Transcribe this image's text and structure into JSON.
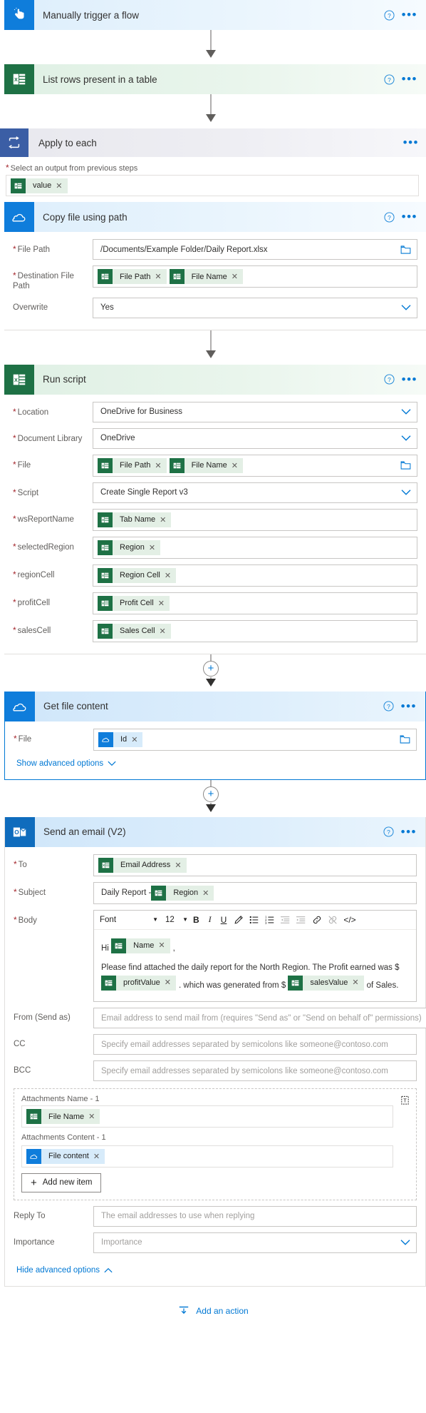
{
  "flow": {
    "trigger": {
      "title": "Manually trigger a flow",
      "icon": "manual-trigger-icon"
    },
    "list_rows": {
      "title": "List rows present in a table",
      "icon": "excel-icon"
    },
    "apply_to_each": {
      "title": "Apply to each",
      "icon": "loop-icon",
      "field_label": "Select an output from previous steps",
      "token": "value"
    },
    "copy_file": {
      "title": "Copy file using path",
      "icon": "onedrive-icon",
      "fields": [
        {
          "label": "File Path",
          "required": true,
          "type": "text",
          "value": "/Documents/Example Folder/Daily Report.xlsx",
          "trailing": "folder-icon"
        },
        {
          "label": "Destination File Path",
          "required": true,
          "type": "tokens",
          "tokens": [
            "File Path",
            "File Name"
          ]
        },
        {
          "label": "Overwrite",
          "required": false,
          "type": "dropdown",
          "value": "Yes"
        }
      ]
    },
    "run_script": {
      "title": "Run script",
      "icon": "excel-icon",
      "fields": [
        {
          "label": "Location",
          "required": true,
          "type": "dropdown",
          "value": "OneDrive for Business"
        },
        {
          "label": "Document Library",
          "required": true,
          "type": "dropdown",
          "value": "OneDrive"
        },
        {
          "label": "File",
          "required": true,
          "type": "tokens",
          "tokens": [
            "File Path",
            "File Name"
          ],
          "trailing": "folder-icon"
        },
        {
          "label": "Script",
          "required": true,
          "type": "dropdown",
          "value": "Create Single Report v3"
        },
        {
          "label": "wsReportName",
          "required": true,
          "type": "tokens",
          "tokens": [
            "Tab Name"
          ]
        },
        {
          "label": "selectedRegion",
          "required": true,
          "type": "tokens",
          "tokens": [
            "Region"
          ]
        },
        {
          "label": "regionCell",
          "required": true,
          "type": "tokens",
          "tokens": [
            "Region Cell"
          ]
        },
        {
          "label": "profitCell",
          "required": true,
          "type": "tokens",
          "tokens": [
            "Profit Cell"
          ]
        },
        {
          "label": "salesCell",
          "required": true,
          "type": "tokens",
          "tokens": [
            "Sales Cell"
          ]
        }
      ]
    },
    "get_file_content": {
      "title": "Get file content",
      "icon": "onedrive-icon",
      "file_label": "File",
      "file_token": "Id",
      "advanced_link": "Show advanced options"
    },
    "send_email": {
      "title": "Send an email (V2)",
      "icon": "outlook-icon",
      "to_label": "To",
      "to_token": "Email Address",
      "subject_label": "Subject",
      "subject_text": "Daily Report - ",
      "subject_token": "Region",
      "body_label": "Body",
      "toolbar": {
        "font": "Font",
        "size": "12",
        "bold": "B",
        "italic": "I",
        "underline": "U"
      },
      "body": {
        "greeting_prefix": "Hi",
        "greeting_token": "Name",
        "greeting_suffix": ",",
        "para_part1": "Please find attached the daily report for the North Region.  The Profit earned was $",
        "token_profit": "profitValue",
        "para_part2": ". which was generated from $",
        "token_sales": "salesValue",
        "para_part3": "of Sales."
      },
      "from_label": "From (Send as)",
      "from_placeholder": "Email address to send mail from (requires \"Send as\" or \"Send on behalf of\" permissions)",
      "cc_label": "CC",
      "cc_placeholder": "Specify email addresses separated by semicolons like someone@contoso.com",
      "bcc_label": "BCC",
      "bcc_placeholder": "Specify email addresses separated by semicolons like someone@contoso.com",
      "attachments": {
        "name_label": "Attachments Name - 1",
        "name_token": "File Name",
        "content_label": "Attachments Content - 1",
        "content_token": "File content",
        "add_button": "Add new item"
      },
      "reply_to_label": "Reply To",
      "reply_to_placeholder": "The email addresses to use when replying",
      "importance_label": "Importance",
      "importance_value": "Importance",
      "advanced_link": "Hide advanced options"
    },
    "footer": {
      "add_action": "Add an action"
    }
  },
  "colors": {
    "accent": "#0078d4",
    "excel_green": "#1e7145",
    "onedrive_blue": "#0f7ddb",
    "loop_blue": "#3b5ea5",
    "required_red": "#a4262c"
  }
}
